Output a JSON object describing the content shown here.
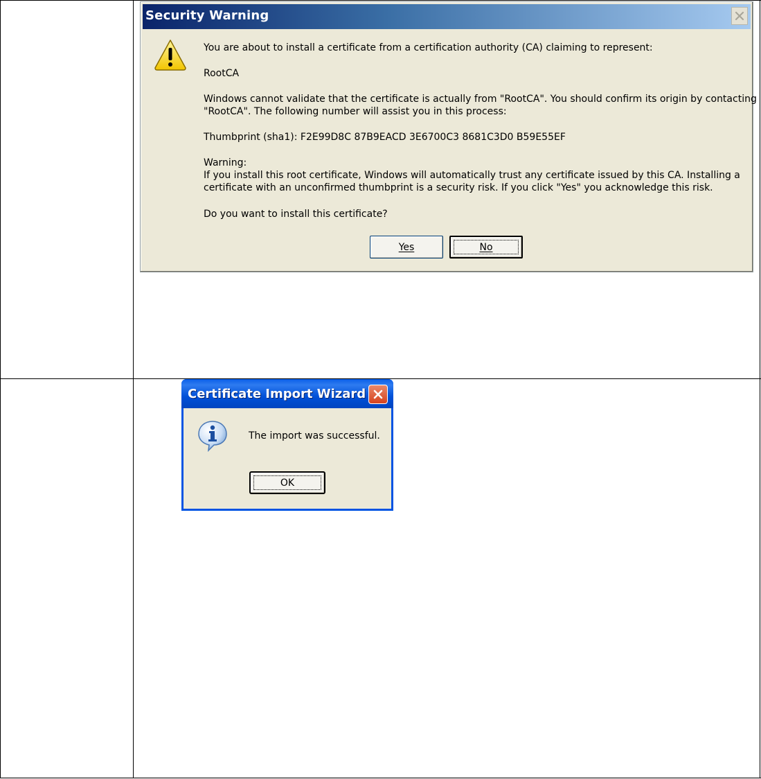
{
  "security_warning": {
    "title": "Security Warning",
    "line_intro": "You are about to install a certificate from a certification authority (CA) claiming to represent:",
    "ca_name": "RootCA",
    "validate_line1": "Windows cannot validate that the certificate is actually from \"RootCA\". You should confirm its origin by contacting",
    "validate_line2": "\"RootCA\". The following number will assist you in this process:",
    "thumbprint": "Thumbprint (sha1): F2E99D8C 87B9EACD 3E6700C3 8681C3D0 B59E55EF",
    "warning_label": "Warning:",
    "warning_line1": "If you install this root certificate, Windows will automatically trust any certificate issued by this CA. Installing a",
    "warning_line2": "certificate with an unconfirmed thumbprint is a security risk. If you click \"Yes\" you acknowledge this risk.",
    "question": "Do you want to install this certificate?",
    "yes_label": "Yes",
    "no_label": "No",
    "icon": "warning-triangle-icon"
  },
  "import_wizard": {
    "title": "Certificate Import Wizard",
    "message": "The import was successful.",
    "ok_label": "OK",
    "icon": "info-icon"
  }
}
